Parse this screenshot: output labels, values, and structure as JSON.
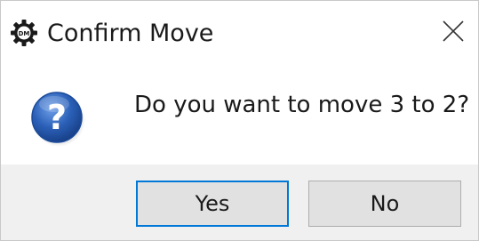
{
  "window": {
    "title": "Confirm Move",
    "app_icon": "dm-gear-icon",
    "close_icon": "close-icon"
  },
  "content": {
    "icon": "question-icon",
    "message": "Do you want to move 3 to 2?"
  },
  "buttons": {
    "yes_label": "Yes",
    "no_label": "No",
    "default": "yes"
  },
  "colors": {
    "accent": "#0078d7",
    "question_icon": "#2b60b8",
    "footer_bg": "#f0f0f0",
    "button_bg": "#e1e1e1"
  }
}
